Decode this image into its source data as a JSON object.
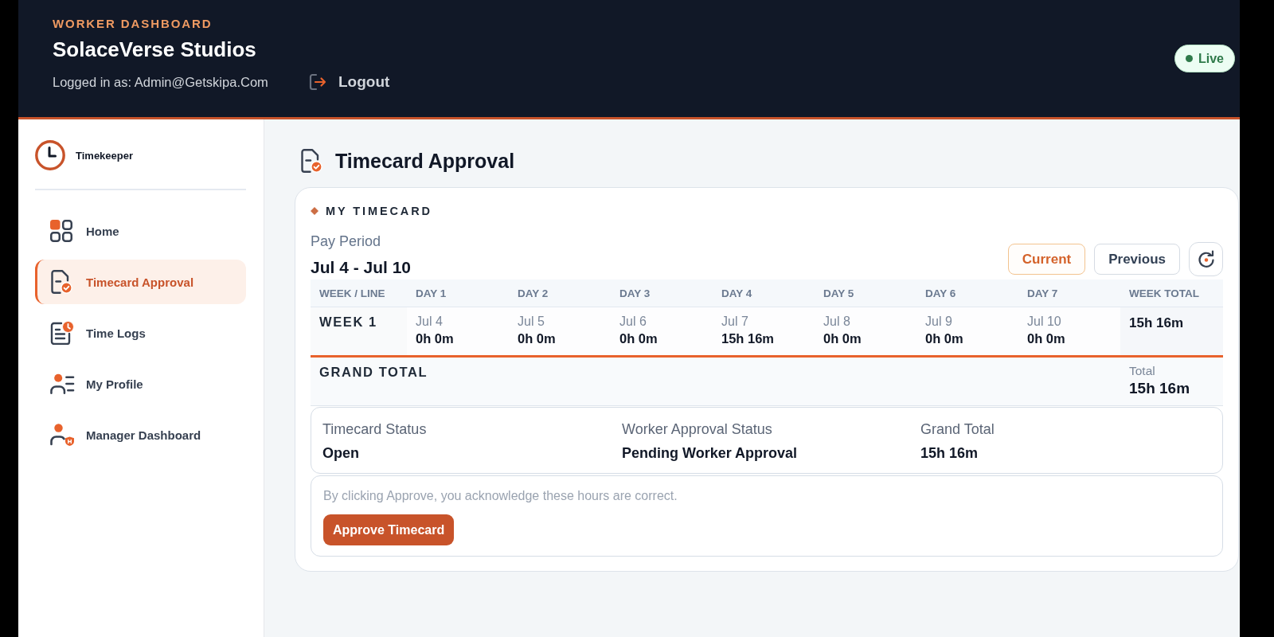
{
  "header": {
    "eyebrow": "WORKER DASHBOARD",
    "title": "SolaceVerse Studios",
    "logged_in": "Logged in as: Admin@Getskipa.Com",
    "logout": "Logout",
    "status": "Live"
  },
  "sidebar": {
    "brand": "Timekeeper",
    "items": [
      {
        "kind": "home",
        "label": "Home",
        "selected": false
      },
      {
        "kind": "timecard",
        "label": "Timecard Approval",
        "selected": true
      },
      {
        "kind": "logs",
        "label": "Time Logs",
        "selected": false
      },
      {
        "kind": "profile",
        "label": "My Profile",
        "selected": false
      },
      {
        "kind": "manager",
        "label": "Manager Dashboard",
        "selected": false
      }
    ]
  },
  "page": {
    "title": "Timecard Approval"
  },
  "timecard": {
    "heading": "MY TIMECARD",
    "pay_period_label": "Pay Period",
    "pay_period": "Jul 4 - Jul 10",
    "period_buttons": [
      {
        "label": "Current",
        "selected": true
      },
      {
        "label": "Previous",
        "selected": false
      }
    ],
    "table": {
      "columns": [
        "WEEK / LINE",
        "DAY 1",
        "DAY 2",
        "DAY 3",
        "DAY 4",
        "DAY 5",
        "DAY 6",
        "DAY 7",
        "WEEK TOTAL"
      ],
      "rows": [
        {
          "label": "WEEK 1",
          "days": [
            {
              "date": "Jul 4",
              "hours": "0h 0m"
            },
            {
              "date": "Jul 5",
              "hours": "0h 0m"
            },
            {
              "date": "Jul 6",
              "hours": "0h 0m"
            },
            {
              "date": "Jul 7",
              "hours": "15h 16m"
            },
            {
              "date": "Jul 8",
              "hours": "0h 0m"
            },
            {
              "date": "Jul 9",
              "hours": "0h 0m"
            },
            {
              "date": "Jul 10",
              "hours": "0h 0m"
            }
          ],
          "total": "15h 16m"
        }
      ],
      "grand_total": {
        "label": "GRAND TOTAL",
        "total_label": "Total",
        "total": "15h 16m"
      }
    },
    "summary": [
      {
        "label": "Timecard Status",
        "value": "Open"
      },
      {
        "label": "Worker Approval Status",
        "value": "Pending Worker Approval"
      },
      {
        "label": "Grand Total",
        "value": "15h 16m"
      }
    ],
    "approval": {
      "note": "By clicking Approve, you acknowledge these hours are correct.",
      "button": "Approve Timecard"
    }
  }
}
